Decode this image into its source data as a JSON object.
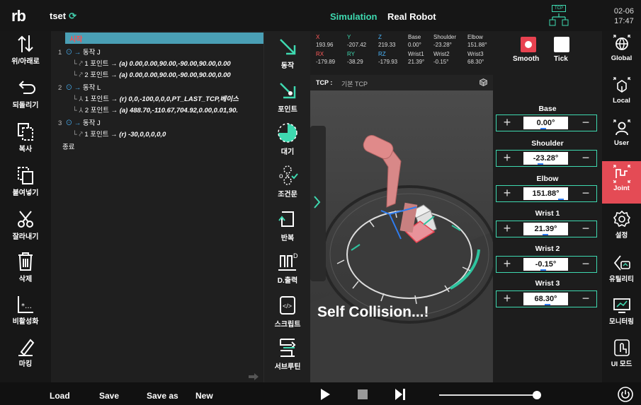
{
  "header": {
    "logo": "rb",
    "project_name": "tset",
    "mode_tabs": [
      "Simulation",
      "Real Robot"
    ],
    "tcp_badge": "TCP",
    "date": "02-06",
    "time": "17:47"
  },
  "left_rail": [
    {
      "label": "위/아래로",
      "icon": "up-down-arrows-icon"
    },
    {
      "label": "되돌리기",
      "icon": "undo-icon"
    },
    {
      "label": "복사",
      "icon": "copy-icon"
    },
    {
      "label": "붙여넣기",
      "icon": "paste-icon"
    },
    {
      "label": "잘라내기",
      "icon": "scissors-icon"
    },
    {
      "label": "삭제",
      "icon": "trash-icon"
    },
    {
      "label": "비활성화",
      "icon": "disable-icon"
    },
    {
      "label": "마킹",
      "icon": "marker-icon"
    }
  ],
  "program": {
    "start": "시작",
    "end": "종료",
    "lines": [
      {
        "num": "1",
        "text": "동작 J"
      },
      {
        "num": "",
        "text": "1 포인트 → ",
        "value": "(a) 0.00,0.00,90.00,-90.00,90.00,0.00"
      },
      {
        "num": "",
        "text": "2 포인트 → ",
        "value": "(a) 0.00,0.00,90.00,-90.00,90.00,0.00"
      },
      {
        "num": "2",
        "text": "동작 L"
      },
      {
        "num": "",
        "text": "1 포인트 → ",
        "value": "(r) 0,0,-100,0,0,0,PT_LAST_TCP,베이스"
      },
      {
        "num": "",
        "text": "2 포인트 → ",
        "value": "(a) 488.70,-110.67,704.92,0.00,0.01,90."
      },
      {
        "num": "3",
        "text": "동작 J"
      },
      {
        "num": "",
        "text": "1 포인트 → ",
        "value": "(r) -30,0,0,0,0,0"
      }
    ]
  },
  "commands": [
    {
      "label": "동작",
      "icon": "move-arrow-icon"
    },
    {
      "label": "포인트",
      "icon": "point-icon"
    },
    {
      "label": "대기",
      "icon": "wait-icon"
    },
    {
      "label": "조건문",
      "icon": "condition-icon"
    },
    {
      "label": "반복",
      "icon": "repeat-icon"
    },
    {
      "label": "D.출력",
      "icon": "digital-out-icon"
    },
    {
      "label": "스크립트",
      "icon": "script-icon"
    },
    {
      "label": "서브루틴",
      "icon": "subroutine-icon"
    }
  ],
  "coords": {
    "x_label": "X",
    "x": "193.96",
    "y_label": "Y",
    "y": "-207.42",
    "z_label": "Z",
    "z": "219.33",
    "rx_label": "RX",
    "rx": "-179.89",
    "ry_label": "RY",
    "ry": "-38.29",
    "rz_label": "RZ",
    "rz": "-179.93",
    "base_label": "Base",
    "base": "0.00°",
    "shoulder_label": "Shoulder",
    "shoulder": "-23.28°",
    "elbow_label": "Elbow",
    "elbow": "151.88°",
    "wrist1_label": "Wrist1",
    "wrist1": "21.39°",
    "wrist2_label": "Wrist2",
    "wrist2": "-0.15°",
    "wrist3_label": "Wrist3",
    "wrist3": "68.30°"
  },
  "tcp": {
    "label": "TCP :",
    "value": "기본 TCP"
  },
  "viewport_message": "Self Collision...!",
  "toggles": [
    {
      "label": "Smooth",
      "color": "#e84250"
    },
    {
      "label": "Tick",
      "color": "#ffffff"
    }
  ],
  "joints": [
    {
      "name": "Base",
      "value": "0.00°",
      "level": 0.5
    },
    {
      "name": "Shoulder",
      "value": "-23.28°",
      "level": 0.44
    },
    {
      "name": "Elbow",
      "value": "151.88°",
      "level": 0.9
    },
    {
      "name": "Wrist 1",
      "value": "21.39°",
      "level": 0.56
    },
    {
      "name": "Wrist 2",
      "value": "-0.15°",
      "level": 0.5
    },
    {
      "name": "Wrist 3",
      "value": "68.30°",
      "level": 0.6
    }
  ],
  "right_rail": [
    {
      "label": "Global",
      "icon": "globe-icon"
    },
    {
      "label": "Local",
      "icon": "local-frame-icon"
    },
    {
      "label": "User",
      "icon": "user-icon"
    },
    {
      "label": "Joint",
      "icon": "joint-icon",
      "active": true
    },
    {
      "label": "설정",
      "icon": "settings-icon"
    },
    {
      "label": "유틸리티",
      "icon": "utility-icon"
    },
    {
      "label": "모니터링",
      "icon": "monitor-icon"
    },
    {
      "label": "UI 모드",
      "icon": "touch-icon"
    }
  ],
  "bottom": {
    "load": "Load",
    "save": "Save",
    "save_as": "Save as",
    "new": "New",
    "speed": 0.97
  },
  "colors": {
    "accent": "#3ed9b0",
    "active": "#e44b55",
    "header_row": "#4a9fb5"
  }
}
